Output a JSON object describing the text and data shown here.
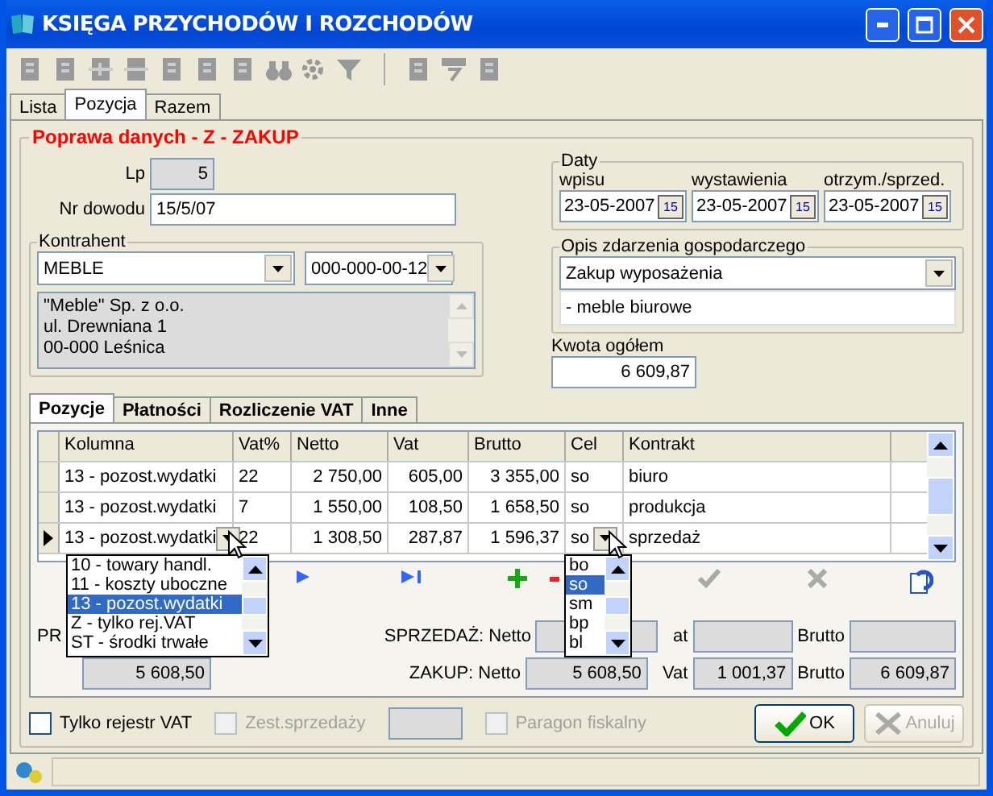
{
  "window": {
    "title": "KSIĘGA PRZYCHODÓW I ROZCHODÓW"
  },
  "tabs": [
    {
      "label": "Lista",
      "selected": false
    },
    {
      "label": "Pozycja",
      "selected": true
    },
    {
      "label": "Razem",
      "selected": false
    }
  ],
  "form": {
    "legend": "Poprawa danych - Z - ZAKUP",
    "lp_label": "Lp",
    "lp": "5",
    "nr_label": "Nr dowodu",
    "nr": "15/5/07",
    "kontrahent": {
      "legend": "Kontrahent",
      "name": "MEBLE",
      "nip": "000-000-00-12",
      "address": [
        "\"Meble\" Sp. z o.o.",
        "ul. Drewniana 1",
        "00-000 Leśnica"
      ]
    },
    "daty": {
      "legend": "Daty",
      "dates": [
        {
          "label": "wpisu",
          "value": "23-05-2007",
          "button": "15"
        },
        {
          "label": "wystawienia",
          "value": "23-05-2007",
          "button": "15"
        },
        {
          "label": "otrzym./sprzed.",
          "value": "23-05-2007",
          "button": "15"
        }
      ]
    },
    "opis": {
      "legend": "Opis zdarzenia gospodarczego",
      "value": "Zakup wyposażenia",
      "detail": "- meble biurowe"
    },
    "kwota": {
      "label": "Kwota ogółem",
      "value": "6 609,87"
    }
  },
  "inner_tabs": [
    {
      "label": "Pozycje",
      "selected": true
    },
    {
      "label": "Płatności",
      "selected": false
    },
    {
      "label": "Rozliczenie VAT",
      "selected": false
    },
    {
      "label": "Inne",
      "selected": false
    }
  ],
  "table": {
    "columns": [
      "Kolumna",
      "Vat%",
      "Netto",
      "Vat",
      "Brutto",
      "Cel",
      "Kontrakt"
    ],
    "rows": [
      {
        "cells": [
          "13 - pozost.wydatki",
          "22",
          "2 750,00",
          "605,00",
          "3 355,00",
          "so",
          "biuro"
        ],
        "selected": false
      },
      {
        "cells": [
          "13 - pozost.wydatki",
          "7",
          "1 550,00",
          "108,50",
          "1 658,50",
          "so",
          "produkcja"
        ],
        "selected": false
      },
      {
        "cells": [
          "13 - pozost.wydatki",
          "22",
          "1 308,50",
          "287,87",
          "1 596,37",
          "so",
          "sprzedaż"
        ],
        "selected": true
      }
    ]
  },
  "kolumna_dropdown": [
    {
      "label": "10 - towary handl.",
      "selected": false
    },
    {
      "label": "11 - koszty uboczne",
      "selected": false
    },
    {
      "label": "13 - pozost.wydatki",
      "selected": true
    },
    {
      "label": "Z - tylko rej.VAT",
      "selected": false
    },
    {
      "label": "ST - środki trwałe",
      "selected": false
    }
  ],
  "cel_dropdown": [
    {
      "label": "bo",
      "selected": false
    },
    {
      "label": "so",
      "selected": true
    },
    {
      "label": "sm",
      "selected": false
    },
    {
      "label": "bp",
      "selected": false
    },
    {
      "label": "bl",
      "selected": false
    }
  ],
  "totals": {
    "przychod_label": "PR",
    "rozchod_value": "5 608,50",
    "sprzedaz": {
      "label": "SPRZEDAŻ: Netto",
      "vat_label": "at",
      "brutto_label": "Brutto"
    },
    "zakup": {
      "label": "ZAKUP: Netto",
      "netto": "5 608,50",
      "vat_label": "Vat",
      "vat": "1 001,37",
      "brutto_label": "Brutto",
      "brutto": "6 609,87"
    }
  },
  "options": [
    {
      "label": "Tylko rejestr VAT",
      "checked": false,
      "disabled": false
    },
    {
      "label": "Zest.sprzedaży",
      "checked": false,
      "disabled": true
    },
    {
      "label": "Paragon fiskalny",
      "checked": false,
      "disabled": true
    }
  ],
  "buttons": [
    {
      "label": "OK",
      "kind": "ok",
      "disabled": false
    },
    {
      "label": "Anuluj",
      "kind": "cancel",
      "disabled": true
    }
  ]
}
